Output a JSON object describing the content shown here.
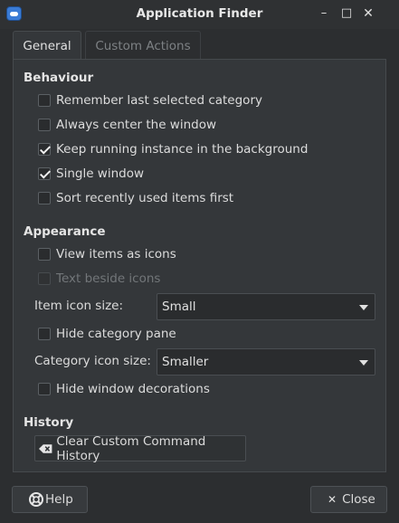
{
  "window": {
    "title": "Application Finder",
    "controls": {
      "minimize": "–",
      "maximize": "□",
      "close": "✕"
    }
  },
  "tabs": [
    {
      "label": "General",
      "active": true
    },
    {
      "label": "Custom Actions",
      "active": false
    }
  ],
  "behaviour": {
    "heading": "Behaviour",
    "options": [
      {
        "label": "Remember last selected category",
        "checked": false,
        "disabled": false
      },
      {
        "label": "Always center the window",
        "checked": false,
        "disabled": false
      },
      {
        "label": "Keep running instance in the background",
        "checked": true,
        "disabled": false
      },
      {
        "label": "Single window",
        "checked": true,
        "disabled": false
      },
      {
        "label": "Sort recently used items first",
        "checked": false,
        "disabled": false
      }
    ]
  },
  "appearance": {
    "heading": "Appearance",
    "view_as_icons": {
      "label": "View items as icons",
      "checked": false
    },
    "text_beside_icons": {
      "label": "Text beside icons",
      "checked": false,
      "disabled": true
    },
    "item_icon_size": {
      "label": "Item icon size:",
      "value": "Small"
    },
    "hide_category_pane": {
      "label": "Hide category pane",
      "checked": false
    },
    "category_icon_size": {
      "label": "Category icon size:",
      "value": "Smaller"
    },
    "hide_window_decorations": {
      "label": "Hide window decorations",
      "checked": false
    }
  },
  "history": {
    "heading": "History",
    "clear_button": "Clear Custom Command History"
  },
  "footer": {
    "help_label": "Help",
    "close_label": "Close"
  },
  "colors": {
    "background": "#2c2e30",
    "panel": "#34373a",
    "accent_icon": "#3a7bd5"
  }
}
